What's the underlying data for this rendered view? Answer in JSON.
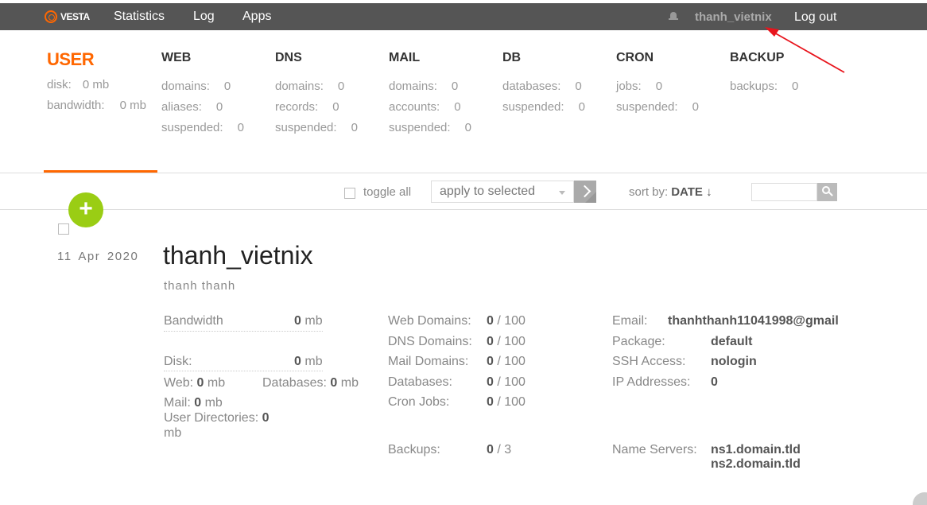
{
  "topbar": {
    "logo_text": "VESTA",
    "nav": [
      "Statistics",
      "Log",
      "Apps"
    ],
    "username": "thanh_vietnix",
    "logout": "Log out"
  },
  "stats": {
    "user": {
      "title": "USER",
      "rows": [
        {
          "label": "disk:",
          "value": "0 mb"
        },
        {
          "label": "bandwidth:",
          "value": "0 mb"
        }
      ]
    },
    "web": {
      "title": "WEB",
      "rows": [
        {
          "label": "domains:",
          "value": "0"
        },
        {
          "label": "aliases:",
          "value": "0"
        },
        {
          "label": "suspended:",
          "value": "0"
        }
      ]
    },
    "dns": {
      "title": "DNS",
      "rows": [
        {
          "label": "domains:",
          "value": "0"
        },
        {
          "label": "records:",
          "value": "0"
        },
        {
          "label": "suspended:",
          "value": "0"
        }
      ]
    },
    "mail": {
      "title": "MAIL",
      "rows": [
        {
          "label": "domains:",
          "value": "0"
        },
        {
          "label": "accounts:",
          "value": "0"
        },
        {
          "label": "suspended:",
          "value": "0"
        }
      ]
    },
    "db": {
      "title": "DB",
      "rows": [
        {
          "label": "databases:",
          "value": "0"
        },
        {
          "label": "suspended:",
          "value": "0"
        }
      ]
    },
    "cron": {
      "title": "CRON",
      "rows": [
        {
          "label": "jobs:",
          "value": "0"
        },
        {
          "label": "suspended:",
          "value": "0"
        }
      ]
    },
    "backup": {
      "title": "BACKUP",
      "rows": [
        {
          "label": "backups:",
          "value": "0"
        }
      ]
    }
  },
  "toolbar": {
    "toggle_all": "toggle all",
    "apply_selected": "apply to selected",
    "sort_by_label": "sort by:",
    "sort_by_value": "DATE ↓"
  },
  "entry": {
    "date": "11 Apr 2020",
    "username": "thanh_vietnix",
    "fullname": "thanh thanh",
    "bandwidth": {
      "label": "Bandwidth",
      "value": "0",
      "unit": "mb"
    },
    "disk": {
      "label": "Disk:",
      "value": "0",
      "unit": "mb"
    },
    "web": {
      "label": "Web:",
      "value": "0",
      "unit": "mb"
    },
    "databases": {
      "label": "Databases:",
      "value": "0",
      "unit": "mb"
    },
    "mail": {
      "label": "Mail:",
      "value": "0",
      "unit": "mb"
    },
    "user_dirs": {
      "label": "User Directories:",
      "value": "0",
      "unit": "mb"
    },
    "limits": [
      {
        "label": "Web Domains:",
        "used": "0",
        "limit": "/ 100"
      },
      {
        "label": "DNS Domains:",
        "used": "0",
        "limit": "/ 100"
      },
      {
        "label": "Mail Domains:",
        "used": "0",
        "limit": "/ 100"
      },
      {
        "label": "Databases:",
        "used": "0",
        "limit": "/ 100"
      },
      {
        "label": "Cron Jobs:",
        "used": "0",
        "limit": "/ 100"
      }
    ],
    "backups": {
      "label": "Backups:",
      "used": "0",
      "limit": "/ 3"
    },
    "email": {
      "label": "Email:",
      "value": "thanhthanh11041998@gmail"
    },
    "package": {
      "label": "Package:",
      "value": "default"
    },
    "ssh": {
      "label": "SSH Access:",
      "value": "nologin"
    },
    "ips": {
      "label": "IP Addresses:",
      "value": "0"
    },
    "nameservers": {
      "label": "Name Servers:",
      "ns1": "ns1.domain.tld",
      "ns2": "ns2.domain.tld"
    }
  },
  "colors": {
    "accent": "#ff6701",
    "add": "#9acd14",
    "topbar": "#555555",
    "annotation": "#e8141c"
  }
}
